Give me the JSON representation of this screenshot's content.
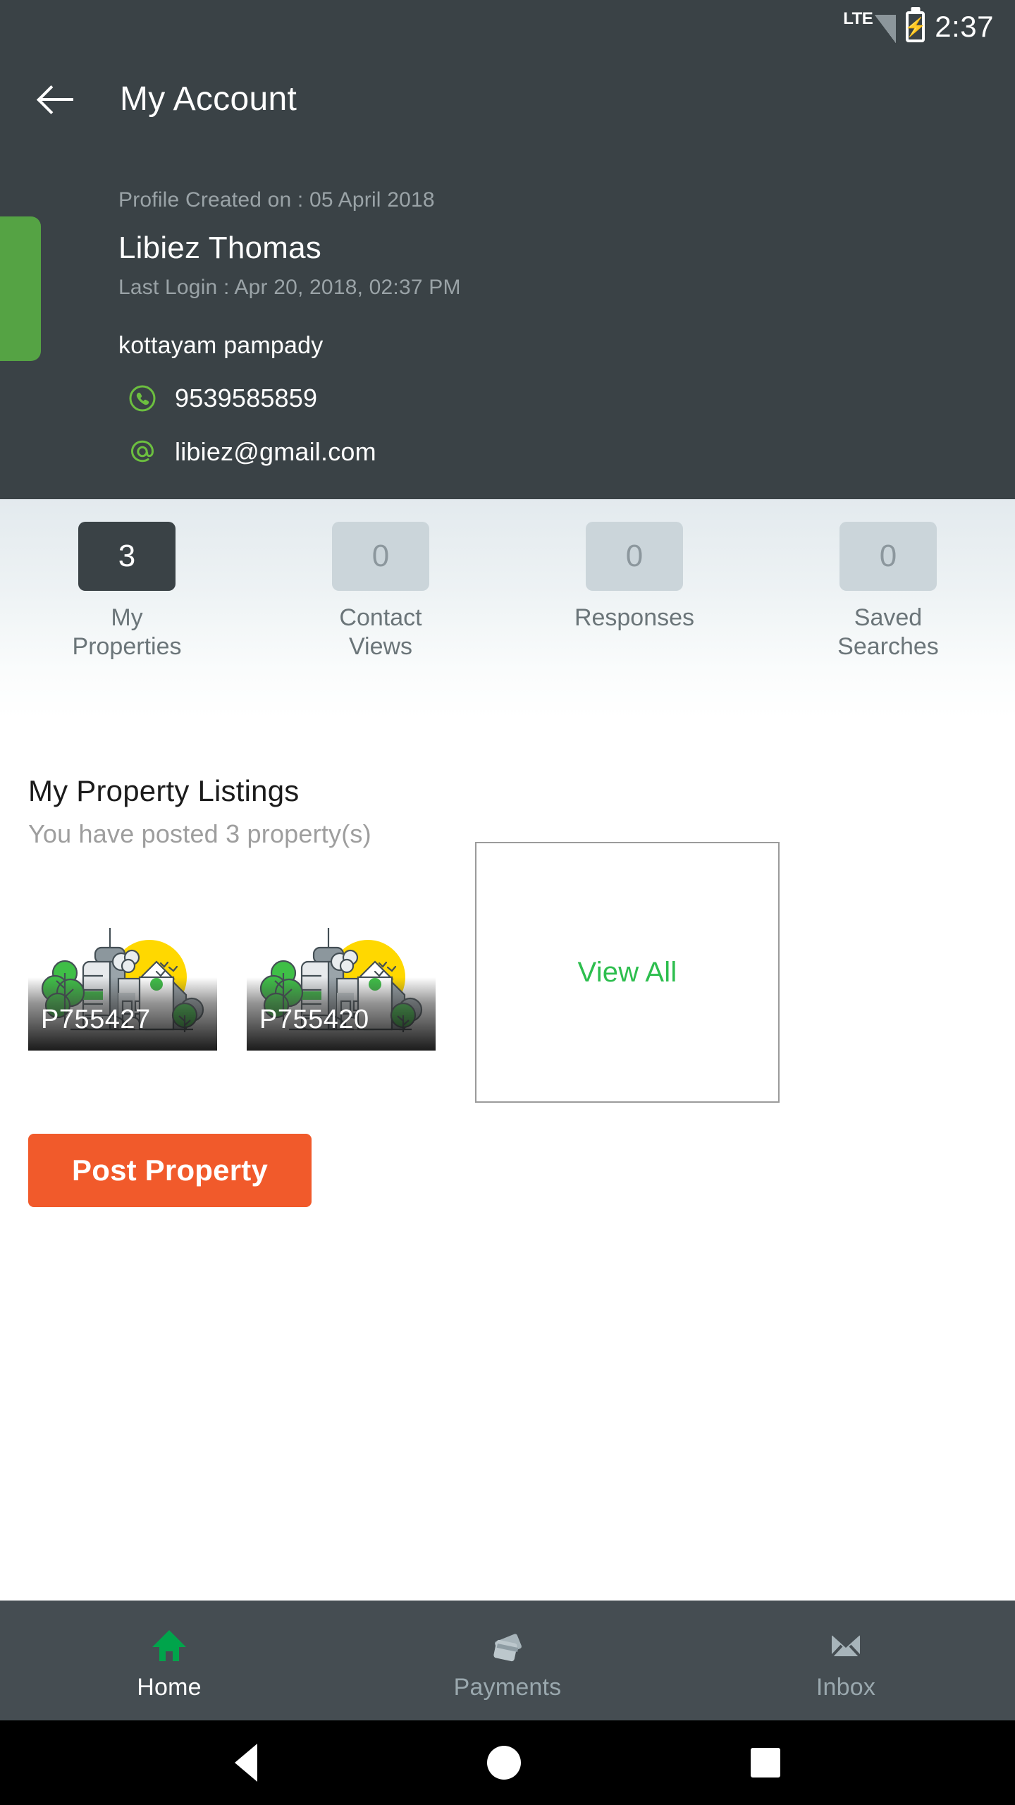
{
  "status_bar": {
    "network": "LTE",
    "time": "2:37",
    "battery_icon": "battery-charging-icon",
    "signal_icon": "signal-bars-icon"
  },
  "app_bar": {
    "back_icon": "back-arrow-icon",
    "title": "My Account"
  },
  "profile": {
    "created_on": "Profile Created on : 05 April 2018",
    "name": "Libiez Thomas",
    "last_login": "Last Login : Apr 20, 2018, 02:37 PM",
    "address": "kottayam pampady",
    "phone": "9539585859",
    "email": "libiez@gmail.com",
    "phone_icon": "phone-icon",
    "email_icon": "at-sign-icon",
    "accent_color": "#55A344",
    "header_color": "#3A4246"
  },
  "stats": [
    {
      "value": "3",
      "label": "My\nProperties",
      "label_line1": "My",
      "label_line2": "Properties",
      "active": true
    },
    {
      "value": "0",
      "label": "Contact Views",
      "label_line1": "Contact",
      "label_line2": "Views",
      "active": false
    },
    {
      "value": "0",
      "label": "Responses",
      "label_line1": "Responses",
      "label_line2": "",
      "active": false
    },
    {
      "value": "0",
      "label": "Saved Searches",
      "label_line1": "Saved",
      "label_line2": "Searches",
      "active": false
    }
  ],
  "listings": {
    "title": "My Property Listings",
    "subtitle": "You have posted 3 property(s)",
    "cards": [
      {
        "id": "P755427",
        "thumbnail_icon": "city-illustration-placeholder"
      },
      {
        "id": "P755420",
        "thumbnail_icon": "city-illustration-placeholder"
      }
    ],
    "view_all_label": "View All",
    "view_all_color": "#2DBE4E",
    "post_property_label": "Post Property",
    "post_property_color": "#F15A2B"
  },
  "bottom_nav": [
    {
      "label": "Home",
      "icon": "home-icon",
      "active": true
    },
    {
      "label": "Payments",
      "icon": "credit-cards-icon",
      "active": false
    },
    {
      "label": "Inbox",
      "icon": "envelope-icon",
      "active": false
    }
  ],
  "system_nav": {
    "back_icon": "system-back-icon",
    "home_icon": "system-home-icon",
    "recents_icon": "system-recents-icon"
  }
}
